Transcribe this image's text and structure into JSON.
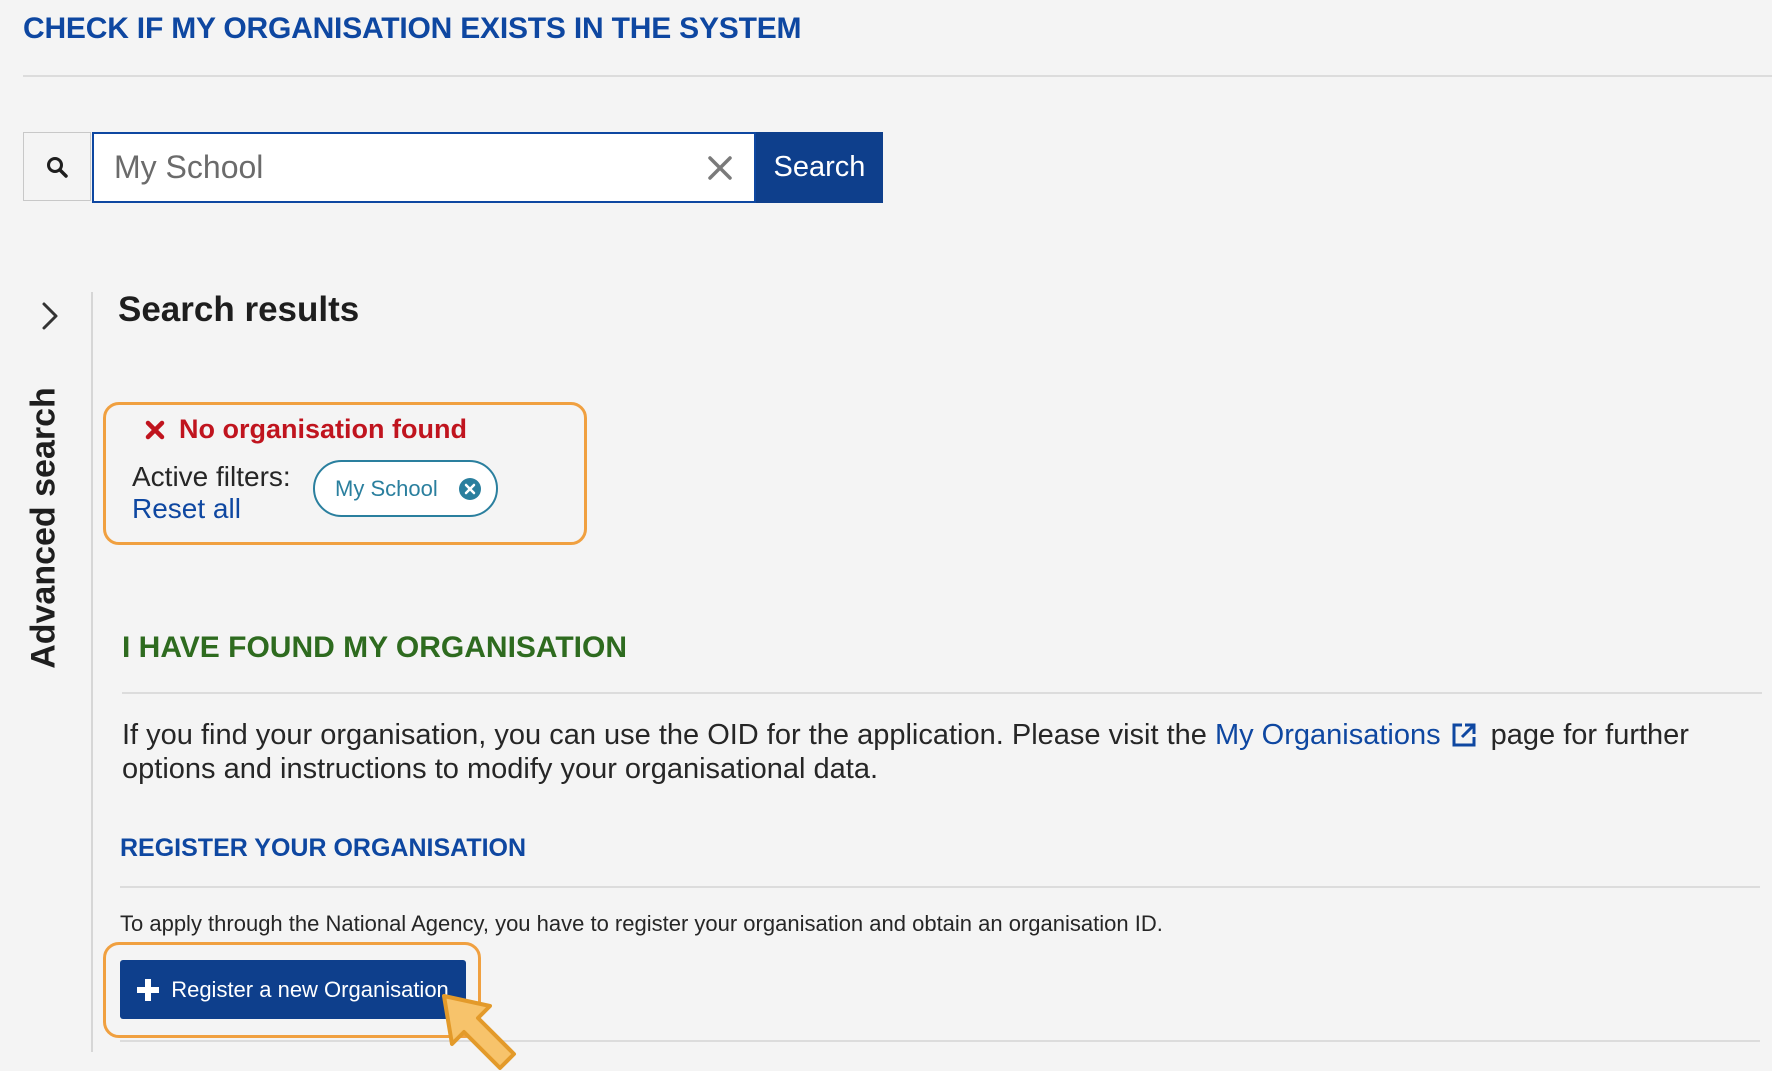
{
  "header": {
    "title": "CHECK IF MY ORGANISATION EXISTS IN THE SYSTEM"
  },
  "search": {
    "icon": "search-icon",
    "value": "My School",
    "clear_icon": "close-icon",
    "button_label": "Search"
  },
  "sidebar": {
    "toggle_icon": "chevron-right-icon",
    "label": "Advanced search"
  },
  "results": {
    "title": "Search results",
    "status": {
      "icon": "x-icon",
      "text": "No organisation found",
      "color": "#c0141e"
    },
    "active_filters_label": "Active filters:",
    "reset_all_label": "Reset all",
    "filter_chips": [
      {
        "label": "My School",
        "remove_icon": "close-circle-icon"
      }
    ]
  },
  "found_section": {
    "title": "I HAVE FOUND MY ORGANISATION",
    "text_before_link": "If you find your organisation, you can use the OID for the application. Please visit the ",
    "link_label": "My Organisations",
    "link_icon": "external-link-icon",
    "text_after_link": " page for further options and instructions to modify your organisational data."
  },
  "register_section": {
    "title": "REGISTER YOUR ORGANISATION",
    "text": "To apply through the National Agency, you have to register your organisation and obtain an organisation ID.",
    "button_icon": "plus-icon",
    "button_label": "Register a new Organisation"
  },
  "colors": {
    "primary_blue": "#0e3f8c",
    "highlight_orange": "#f0a040",
    "success_green": "#2e6b1f"
  }
}
